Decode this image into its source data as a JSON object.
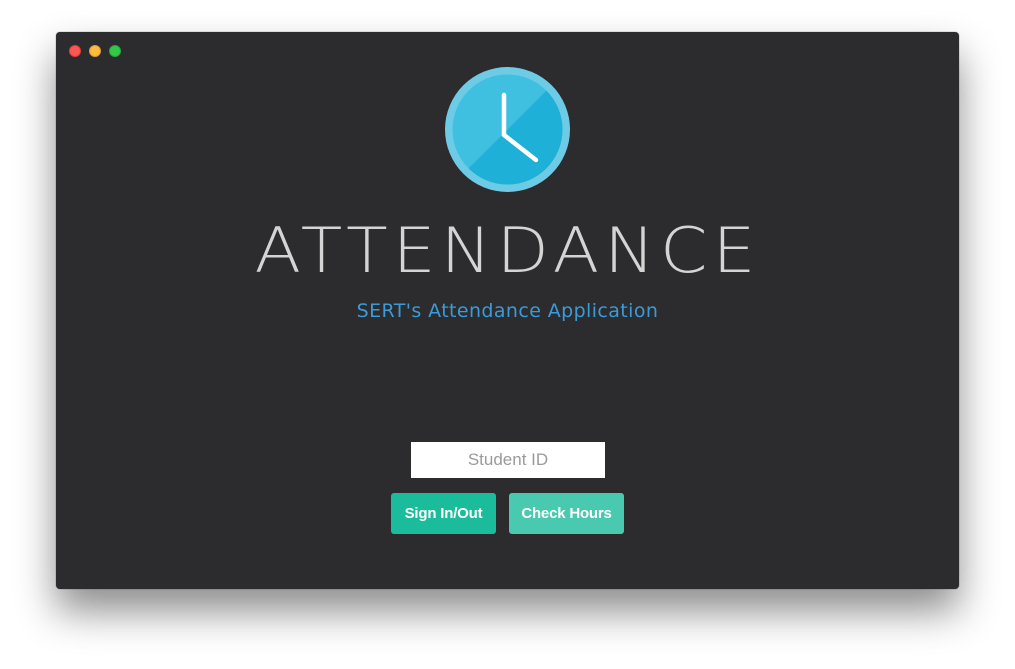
{
  "app": {
    "title": "ATTENDANCE",
    "subtitle": "SERT's Attendance Application"
  },
  "icons": {
    "logo": "clock-icon",
    "window_controls": [
      "close-icon",
      "minimize-icon",
      "zoom-icon"
    ]
  },
  "form": {
    "student_id_placeholder": "Student ID",
    "student_id_value": ""
  },
  "buttons": {
    "sign_in_out": "Sign In/Out",
    "check_hours": "Check Hours"
  },
  "colors": {
    "window_bg": "#2c2c2e",
    "title": "#d4d4d4",
    "subtitle": "#3a9bd9",
    "logo_ring": "#6dcbe6",
    "logo_face": "#1fb4d8",
    "primary_button": "#1abc9c",
    "secondary_button": "#48c9b0"
  }
}
